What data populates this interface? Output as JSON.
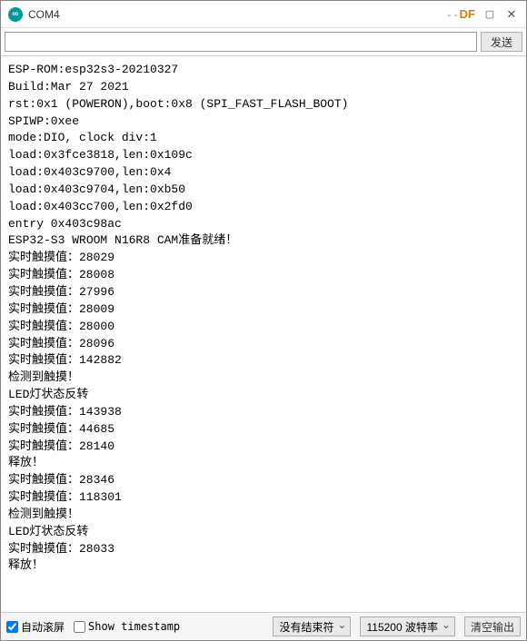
{
  "window": {
    "title": "COM4",
    "brand": "DF"
  },
  "send": {
    "input_value": "",
    "send_button": "发送"
  },
  "console_lines": [
    "ESP-ROM:esp32s3-20210327",
    "Build:Mar 27 2021",
    "rst:0x1 (POWERON),boot:0x8 (SPI_FAST_FLASH_BOOT)",
    "SPIWP:0xee",
    "mode:DIO, clock div:1",
    "load:0x3fce3818,len:0x109c",
    "load:0x403c9700,len:0x4",
    "load:0x403c9704,len:0xb50",
    "load:0x403cc700,len:0x2fd0",
    "entry 0x403c98ac",
    "ESP32-S3 WROOM N16R8 CAM准备就绪！",
    "实时触摸值：28029",
    "实时触摸值：28008",
    "实时触摸值：27996",
    "实时触摸值：28009",
    "实时触摸值：28000",
    "实时触摸值：28096",
    "实时触摸值：142882",
    "检测到触摸！",
    "LED灯状态反转",
    "实时触摸值：143938",
    "实时触摸值：44685",
    "实时触摸值：28140",
    "释放！",
    "实时触摸值：28346",
    "实时触摸值：118301",
    "检测到触摸！",
    "LED灯状态反转",
    "实时触摸值：28033",
    "释放！"
  ],
  "bottom": {
    "autoscroll_label": "自动滚屏",
    "autoscroll_checked": true,
    "timestamp_label": "Show timestamp",
    "timestamp_checked": false,
    "line_ending": "没有结束符",
    "baud_label": "波特率",
    "baud_value": "115200",
    "clear_button": "清空输出"
  }
}
